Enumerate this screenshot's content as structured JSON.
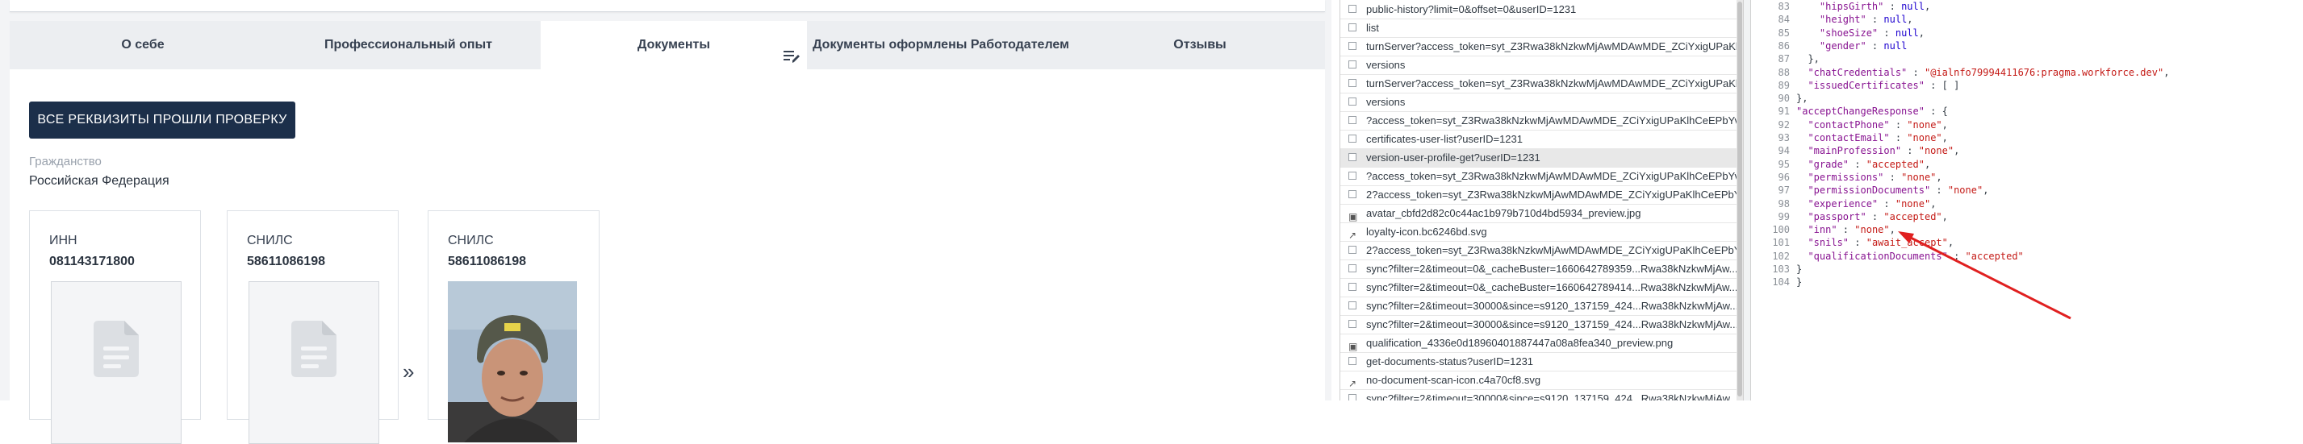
{
  "tabs": [
    {
      "label": "О себе"
    },
    {
      "label": "Профессиональный опыт"
    },
    {
      "label": "Документы"
    },
    {
      "label": "Документы оформлены Работодателем"
    },
    {
      "label": "Отзывы"
    }
  ],
  "colors": {
    "accent_button": "#1c2f4a",
    "annotation_arrow": "#e02020"
  },
  "main": {
    "verify_button": "ВСЕ РЕКВИЗИТЫ ПРОШЛИ ПРОВЕРКУ",
    "citizenship_label": "Гражданство",
    "citizenship_value": "Российская Федерация",
    "documents": [
      {
        "title": "ИНН",
        "number": "081143171800",
        "preview": "placeholder"
      },
      {
        "title": "СНИЛС",
        "number": "58611086198",
        "preview": "placeholder"
      },
      {
        "title": "СНИЛС",
        "number": "58611086198",
        "preview": "photo"
      }
    ],
    "more_arrow": "»"
  },
  "network": {
    "requests": [
      {
        "name": "public-history?limit=0&offset=0&userID=1231",
        "icon": "checkbox"
      },
      {
        "name": "list",
        "icon": "checkbox"
      },
      {
        "name": "turnServer?access_token=syt_Z3Rwa38kNzkwMjAwMDAwMDE_ZCiYxigUPaKlhC...",
        "icon": "checkbox"
      },
      {
        "name": "versions",
        "icon": "checkbox"
      },
      {
        "name": "turnServer?access_token=syt_Z3Rwa38kNzkwMjAwMDAwMDE_ZCiYxigUPaKlhC...",
        "icon": "checkbox"
      },
      {
        "name": "versions",
        "icon": "checkbox"
      },
      {
        "name": "?access_token=syt_Z3Rwa38kNzkwMjAwMDAwMDE_ZCiYxigUPaKlhCeEPbYv_2z...",
        "icon": "checkbox"
      },
      {
        "name": "certificates-user-list?userID=1231",
        "icon": "checkbox"
      },
      {
        "name": "version-user-profile-get?userID=1231",
        "icon": "checkbox",
        "selected": true
      },
      {
        "name": "?access_token=syt_Z3Rwa38kNzkwMjAwMDAwMDE_ZCiYxigUPaKlhCeEPbYv_2z...",
        "icon": "checkbox"
      },
      {
        "name": "2?access_token=syt_Z3Rwa38kNzkwMjAwMDAwMDE_ZCiYxigUPaKlhCeEPbYv_2z...",
        "icon": "checkbox"
      },
      {
        "name": "avatar_cbfd2d82c0c44ac1b979b710d4bd5934_preview.jpg",
        "icon": "image"
      },
      {
        "name": "loyalty-icon.bc6246bd.svg",
        "icon": "svg"
      },
      {
        "name": "2?access_token=syt_Z3Rwa38kNzkwMjAwMDAwMDE_ZCiYxigUPaKlhCeEPbYv_2z...",
        "icon": "checkbox"
      },
      {
        "name": "sync?filter=2&timeout=0&_cacheBuster=1660642789359...Rwa38kNzkwMjAw...",
        "icon": "checkbox"
      },
      {
        "name": "sync?filter=2&timeout=0&_cacheBuster=1660642789414...Rwa38kNzkwMjAw...",
        "icon": "checkbox"
      },
      {
        "name": "sync?filter=2&timeout=30000&since=s9120_137159_424...Rwa38kNzkwMjAw...",
        "icon": "checkbox"
      },
      {
        "name": "sync?filter=2&timeout=30000&since=s9120_137159_424...Rwa38kNzkwMjAw...",
        "icon": "checkbox"
      },
      {
        "name": "qualification_4336e0d18960401887447a08a8fea340_preview.png",
        "icon": "image"
      },
      {
        "name": "get-documents-status?userID=1231",
        "icon": "checkbox"
      },
      {
        "name": "no-document-scan-icon.c4a70cf8.svg",
        "icon": "svg"
      },
      {
        "name": "sync?filter=2&timeout=30000&since=s9120_137159_424...Rwa38kNzkwMjAw...",
        "icon": "checkbox"
      }
    ]
  },
  "response": {
    "lines": [
      {
        "num": "83",
        "text": "    \"hipsGirth\" : null,"
      },
      {
        "num": "84",
        "text": "    \"height\" : null,"
      },
      {
        "num": "85",
        "text": "    \"shoeSize\" : null,"
      },
      {
        "num": "86",
        "text": "    \"gender\" : null"
      },
      {
        "num": "87",
        "text": "  },"
      },
      {
        "num": "88",
        "text": "  \"chatCredentials\" : \"@ialnfo79994411676:pragma.workforce.dev\","
      },
      {
        "num": "89",
        "text": "  \"issuedCertificates\" : [ ]"
      },
      {
        "num": "90",
        "text": "},"
      },
      {
        "num": "91",
        "text": "\"acceptChangeResponse\" : {"
      },
      {
        "num": "92",
        "text": "  \"contactPhone\" : \"none\","
      },
      {
        "num": "93",
        "text": "  \"contactEmail\" : \"none\","
      },
      {
        "num": "94",
        "text": "  \"mainProfession\" : \"none\","
      },
      {
        "num": "95",
        "text": "  \"grade\" : \"accepted\","
      },
      {
        "num": "96",
        "text": "  \"permissions\" : \"none\","
      },
      {
        "num": "97",
        "text": "  \"permissionDocuments\" : \"none\","
      },
      {
        "num": "98",
        "text": "  \"experience\" : \"none\","
      },
      {
        "num": "99",
        "text": "  \"passport\" : \"accepted\","
      },
      {
        "num": "100",
        "text": "  \"inn\" : \"none\","
      },
      {
        "num": "101",
        "text": "  \"snils\" : \"await_accept\","
      },
      {
        "num": "102",
        "text": "  \"qualificationDocuments\" : \"accepted\""
      },
      {
        "num": "103",
        "text": "}"
      },
      {
        "num": "104",
        "text": "}"
      }
    ]
  }
}
